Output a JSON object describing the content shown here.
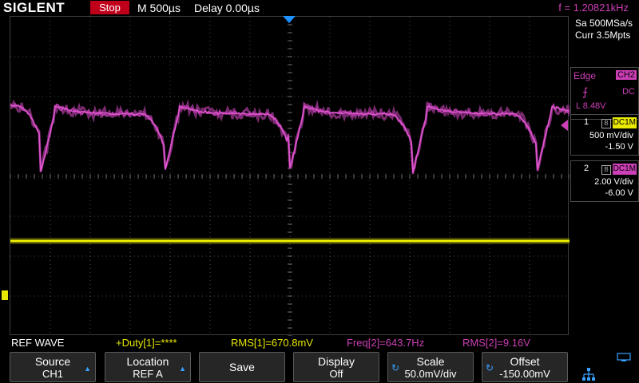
{
  "header": {
    "brand": "SIGLENT",
    "run_status": "Stop",
    "timebase": "M 500µs",
    "delay": "Delay 0.00µs",
    "frequency": "f = 1.20821kHz"
  },
  "acquisition": {
    "sample_rate": "Sa 500MSa/s",
    "memory_depth": "Curr 3.5Mpts"
  },
  "trigger": {
    "type": "Edge",
    "source": "CH2",
    "slope_icon": "rising-edge-icon",
    "coupling": "DC",
    "level": "L  8.48V"
  },
  "channels": [
    {
      "number": "1",
      "bw_limit": "B",
      "coupling": "DC1M",
      "scale": "500 mV/div",
      "offset": "-1.50 V",
      "color": "#e8e800"
    },
    {
      "number": "2",
      "bw_limit": "B",
      "coupling": "DC1M",
      "scale": "2.00 V/div",
      "offset": "-6.00 V",
      "color": "#cc3fb6"
    }
  ],
  "measurements": {
    "ref_wave": "REF WAVE",
    "duty": "+Duty[1]=****",
    "rms1": "RMS[1]=670.8mV",
    "freq2": "Freq[2]=643.7Hz",
    "rms2": "RMS[2]=9.16V"
  },
  "softkeys": [
    {
      "line1": "Source",
      "line2": "CH1",
      "control": "arrow"
    },
    {
      "line1": "Location",
      "line2": "REF A",
      "control": "arrow"
    },
    {
      "line1": "Save",
      "line2": "",
      "control": "none"
    },
    {
      "line1": "Display",
      "line2": "Off",
      "control": "none"
    },
    {
      "line1": "Scale",
      "line2": "50.0mV/div",
      "control": "knob"
    },
    {
      "line1": "Offset",
      "line2": "-150.00mV",
      "control": "knob"
    }
  ],
  "status_icons": [
    "usb-icon",
    "network-icon"
  ],
  "colors": {
    "ch1": "#e8e800",
    "ch2": "#cc3fb6",
    "stop": "#c0001a",
    "accent": "#1e90ff"
  }
}
